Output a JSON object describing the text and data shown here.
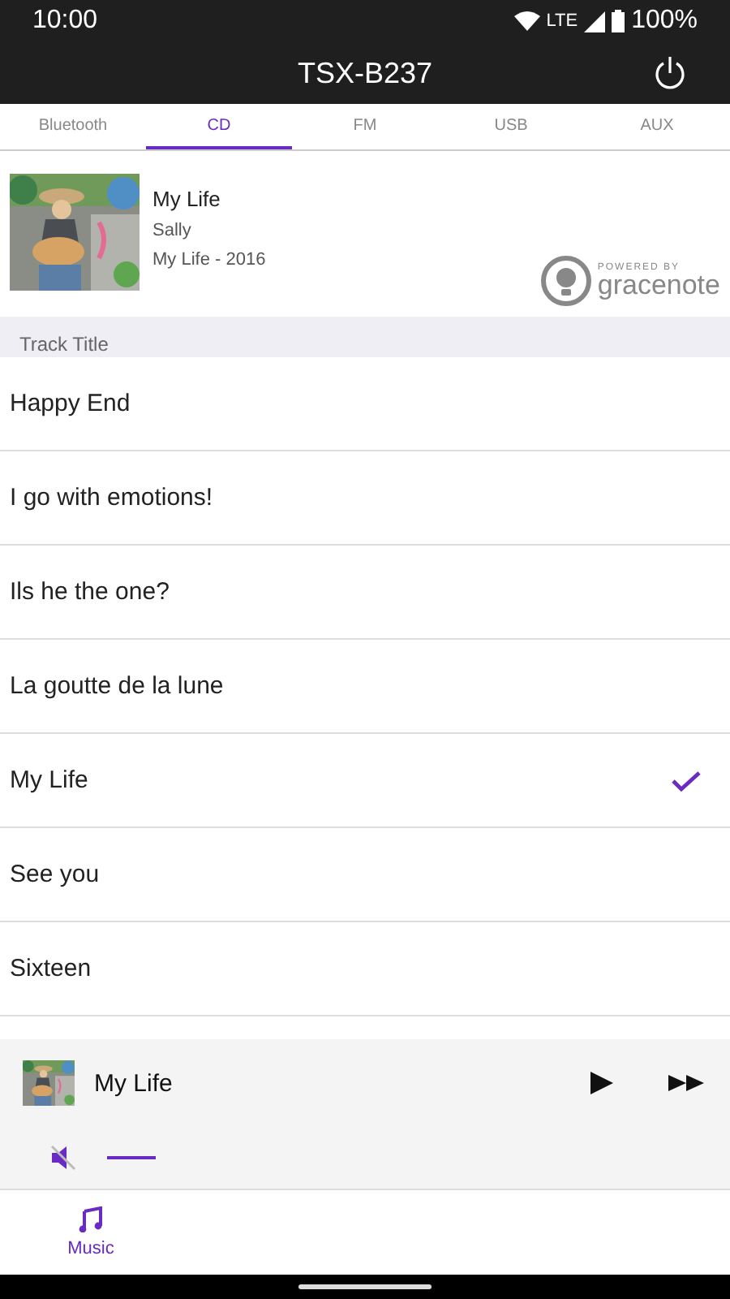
{
  "status_bar": {
    "time": "10:00",
    "network": "LTE",
    "battery": "100%"
  },
  "app_bar": {
    "title": "TSX-B237"
  },
  "tabs": [
    {
      "label": "Bluetooth",
      "selected": false
    },
    {
      "label": "CD",
      "selected": true
    },
    {
      "label": "FM",
      "selected": false
    },
    {
      "label": "USB",
      "selected": false
    },
    {
      "label": "AUX",
      "selected": false
    }
  ],
  "album": {
    "title": "My Life",
    "artist": "Sally",
    "info": "My Life - 2016",
    "credit_small": "POWERED BY",
    "credit_brand": "gracenote"
  },
  "section_header": "Track Title",
  "tracks": [
    {
      "title": "Happy End",
      "selected": false
    },
    {
      "title": "I go with emotions!",
      "selected": false
    },
    {
      "title": "Ils he the one?",
      "selected": false
    },
    {
      "title": "La goutte de la lune",
      "selected": false
    },
    {
      "title": "My Life",
      "selected": true
    },
    {
      "title": "See you",
      "selected": false
    },
    {
      "title": "Sixteen",
      "selected": false
    }
  ],
  "mini_player": {
    "title": "My Life",
    "muted": true
  },
  "bottom_nav": [
    {
      "label": "Music",
      "selected": true
    }
  ]
}
